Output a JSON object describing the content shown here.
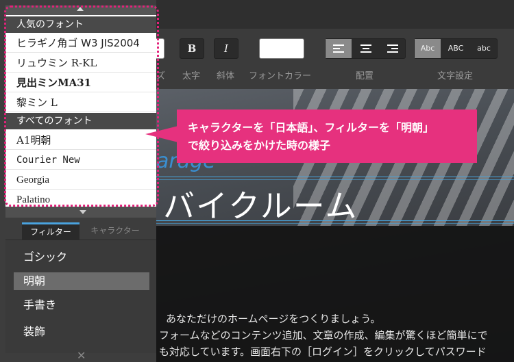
{
  "dropdown": {
    "popular_header": "人気のフォント",
    "popular_fonts": [
      "ヒラギノ角ゴ W3 JIS2004",
      "リュウミン R-KL",
      "見出ミンMA31",
      "黎ミン L"
    ],
    "all_header": "すべてのフォント",
    "all_fonts": [
      "A1明朝",
      "Courier New",
      "Georgia",
      "Palatino"
    ]
  },
  "tabs": {
    "filter": "フィルター",
    "character": "キャラクター"
  },
  "filters": [
    "ゴシック",
    "明朝",
    "手書き",
    "装飾"
  ],
  "selected_filter": "明朝",
  "toolbar": {
    "bold": "B",
    "italic": "I",
    "case_buttons": [
      "Abc",
      "ABC",
      "abc"
    ],
    "labels": {
      "size_partial": "ズ",
      "bold": "太字",
      "italic": "斜体",
      "font_color": "フォントカラー",
      "align": "配置",
      "text_setting": "文字設定"
    }
  },
  "callout": {
    "line1": "キャラクターを「日本語」、フィルターを「明朝」",
    "line2": "で絞り込みをかけた時の様子"
  },
  "preview": {
    "script_heading": "arage",
    "heading": "バイクルーム",
    "lines": [
      "あなただけのホームページをつくりましょう。",
      "フォームなどのコンテンツ追加、文章の作成、編集が驚くほど簡単にで",
      "も対応しています。画面右下の［ログイン］をクリックしてパスワード"
    ]
  },
  "close_icon": "close-icon",
  "colors": {
    "accent": "#e6317e",
    "tab_accent": "#4aa3df"
  }
}
